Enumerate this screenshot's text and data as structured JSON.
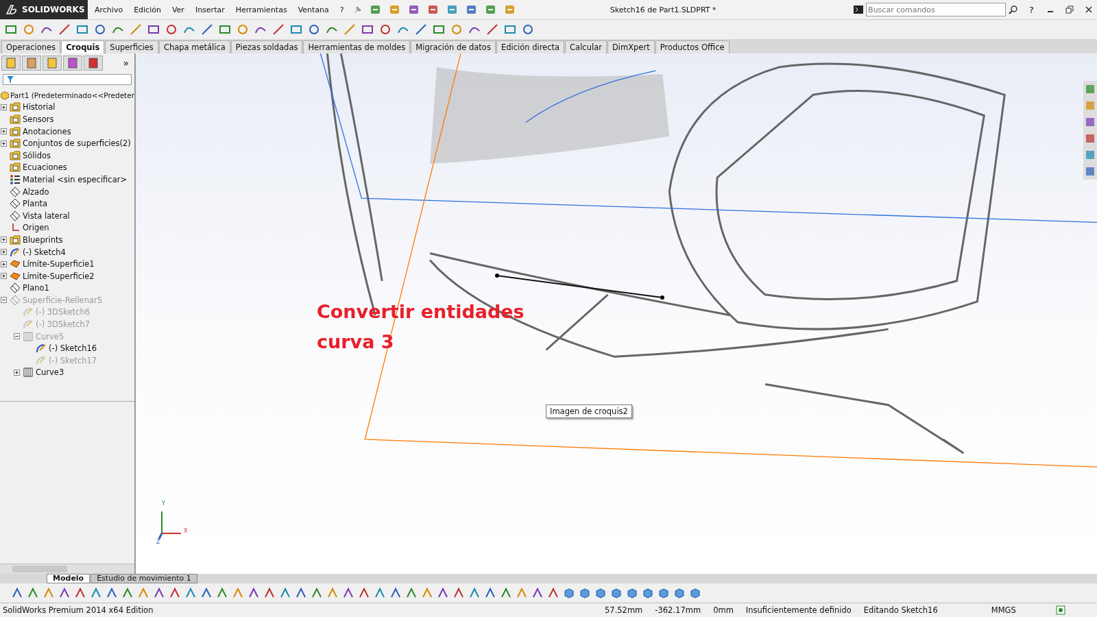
{
  "app": {
    "logo": "SOLIDWORKS",
    "title": "Sketch16 de Part1.SLDPRT *",
    "search": {
      "placeholder": "Buscar comandos"
    },
    "help": "?"
  },
  "menu": [
    "Archivo",
    "Edición",
    "Ver",
    "Insertar",
    "Herramientas",
    "Ventana",
    "?"
  ],
  "command_tabs": [
    {
      "label": "Operaciones",
      "selected": false
    },
    {
      "label": "Croquis",
      "selected": true
    },
    {
      "label": "Superficies",
      "selected": false
    },
    {
      "label": "Chapa metálica",
      "selected": false
    },
    {
      "label": "Piezas soldadas",
      "selected": false
    },
    {
      "label": "Herramientas de moldes",
      "selected": false
    },
    {
      "label": "Migración de datos",
      "selected": false
    },
    {
      "label": "Edición directa",
      "selected": false
    },
    {
      "label": "Calcular",
      "selected": false
    },
    {
      "label": "DimXpert",
      "selected": false
    },
    {
      "label": "Productos Office",
      "selected": false
    }
  ],
  "panel": {
    "more": "»",
    "root": {
      "label": "Part1  (Predeterminado<<Predeter",
      "kind": "part"
    },
    "tree": [
      {
        "label": "Historial",
        "kind": "history",
        "collapsed": true,
        "suppressed": false
      },
      {
        "label": "Sensors",
        "kind": "sensor",
        "collapsed": false,
        "suppressed": false
      },
      {
        "label": "Anotaciones",
        "kind": "annotation",
        "collapsed": true,
        "suppressed": false
      },
      {
        "label": "Conjuntos de superficies(2)",
        "kind": "surfaceset",
        "collapsed": true,
        "suppressed": false
      },
      {
        "label": "Sólidos",
        "kind": "solid",
        "collapsed": false,
        "suppressed": false
      },
      {
        "label": "Ecuaciones",
        "kind": "equation",
        "collapsed": false,
        "suppressed": false
      },
      {
        "label": "Material <sin especificar>",
        "kind": "material",
        "collapsed": false,
        "suppressed": false
      },
      {
        "label": "Alzado",
        "kind": "plane",
        "collapsed": false,
        "suppressed": false
      },
      {
        "label": "Planta",
        "kind": "plane",
        "collapsed": false,
        "suppressed": false
      },
      {
        "label": "Vista lateral",
        "kind": "plane",
        "collapsed": false,
        "suppressed": false
      },
      {
        "label": "Origen",
        "kind": "origin",
        "collapsed": false,
        "suppressed": false
      },
      {
        "label": "Blueprints",
        "kind": "folder",
        "collapsed": true,
        "suppressed": false
      },
      {
        "label": "(-) Sketch4",
        "kind": "sketch",
        "collapsed": true,
        "suppressed": false
      },
      {
        "label": "Límite-Superficie1",
        "kind": "surface",
        "collapsed": true,
        "suppressed": false
      },
      {
        "label": "Límite-Superficie2",
        "kind": "surface",
        "collapsed": true,
        "suppressed": false
      },
      {
        "label": "Plano1",
        "kind": "plane",
        "collapsed": false,
        "suppressed": false
      },
      {
        "label": "Superficie-Rellenar5",
        "kind": "fill",
        "collapsed": false,
        "suppressed": true,
        "children": [
          {
            "label": "(-) 3DSketch6",
            "kind": "sketch3d",
            "collapsed": false,
            "suppressed": true
          },
          {
            "label": "(-) 3DSketch7",
            "kind": "sketch3d",
            "collapsed": false,
            "suppressed": true
          },
          {
            "label": "Curve5",
            "kind": "curve",
            "collapsed": false,
            "suppressed": true,
            "children": [
              {
                "label": "(-) Sketch16",
                "kind": "sketch",
                "collapsed": false,
                "suppressed": false
              },
              {
                "label": "(-) Sketch17",
                "kind": "sketch3d",
                "collapsed": false,
                "suppressed": true
              }
            ]
          },
          {
            "label": "Curve3",
            "kind": "curve",
            "collapsed": true,
            "suppressed": false
          }
        ]
      }
    ]
  },
  "viewport": {
    "annotation": [
      "Convertir entidades",
      "curva 3"
    ],
    "tooltip": "Imagen de croquis2",
    "axes": {
      "x": "X",
      "y": "Y",
      "z": "Z"
    }
  },
  "bottom_tabs": [
    {
      "label": "Modelo",
      "selected": true
    },
    {
      "label": "Estudio de movimiento 1",
      "selected": false
    }
  ],
  "status_bar": {
    "edition": "SolidWorks Premium 2014 x64 Edition",
    "x": "57.52mm",
    "y": "-362.17mm",
    "z": "0mm",
    "state": "Insuficientemente definido",
    "editing": "Editando Sketch16",
    "units": "MMGS"
  }
}
